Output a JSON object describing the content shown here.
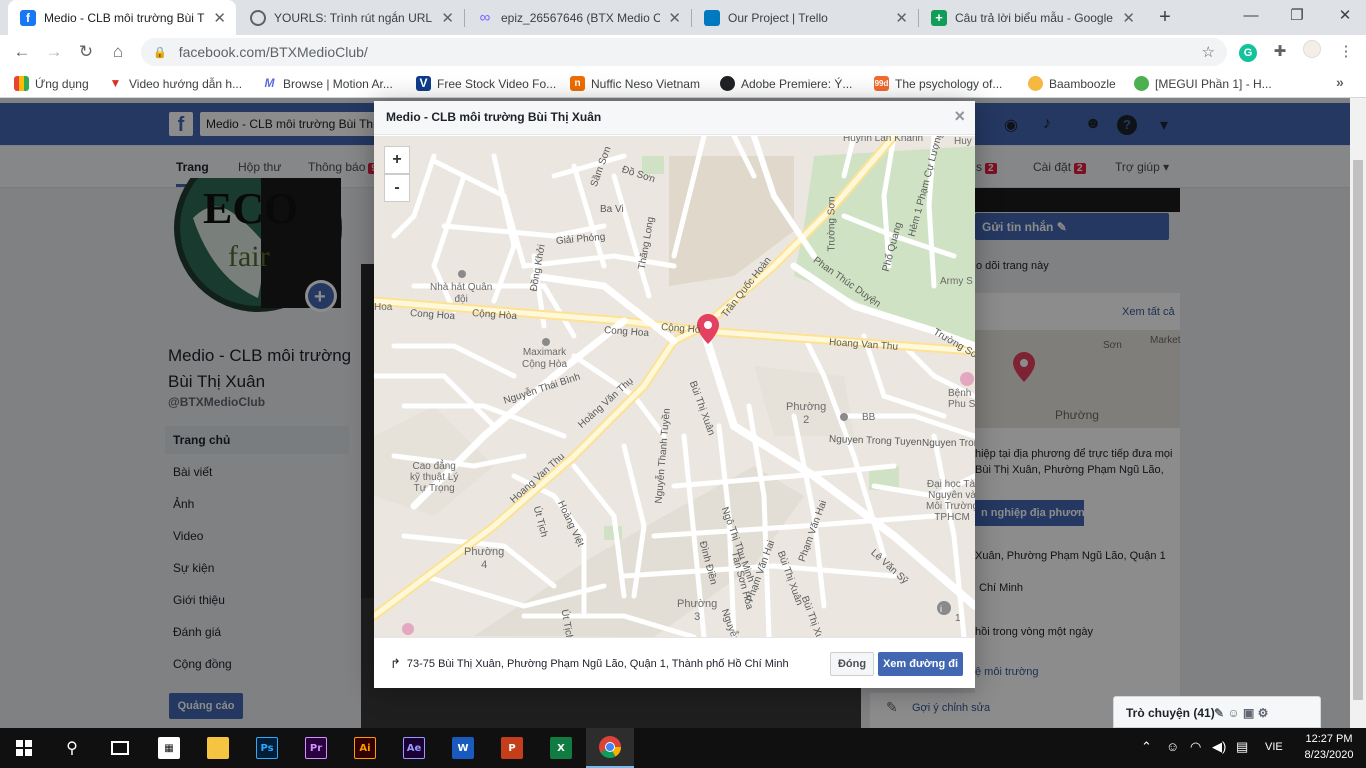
{
  "browser": {
    "tabs": [
      {
        "title": "Medio - CLB môi trường Bùi Thị Xuân",
        "favicon": "facebook-icon",
        "color": "#1877f2",
        "active": true
      },
      {
        "title": "YOURLS: Trình rút ngắn URL của",
        "favicon": "globe-icon",
        "color": "#5f6368",
        "active": false
      },
      {
        "title": "epiz_26567646 (BTX Medio Club",
        "favicon": "infinity-icon",
        "color": "#7b61ff",
        "active": false
      },
      {
        "title": "Our Project | Trello",
        "favicon": "trello-icon",
        "color": "#0079bf",
        "active": false
      },
      {
        "title": "Câu trả lời biểu mẫu - Google",
        "favicon": "google-sheets-icon",
        "color": "#0f9d58",
        "active": false
      }
    ],
    "new_tab": "+",
    "url": "facebook.com/BTXMedioClub/",
    "bookmarks": [
      {
        "label": "Ứng dụng",
        "icon": "apps-grid-icon",
        "color": "#e94235"
      },
      {
        "label": "Video hướng dẫn h...",
        "icon": "bookmark-red-icon",
        "color": "#d93025"
      },
      {
        "label": "Browse | Motion Ar...",
        "icon": "motion-array-icon",
        "color": "#5b6ee1"
      },
      {
        "label": "Free Stock Video Fo...",
        "icon": "v-icon",
        "color": "#0e3b8c"
      },
      {
        "label": "Nuffic Neso Vietnam",
        "icon": "nuffic-icon",
        "color": "#ef6c00"
      },
      {
        "label": "Adobe Premiere: Ý...",
        "icon": "globe-icon",
        "color": "#202124"
      },
      {
        "label": "The psychology of...",
        "icon": "99designs-icon",
        "color": "#f26a2e"
      },
      {
        "label": "Baamboozle",
        "icon": "baamboozle-icon",
        "color": "#f5b942"
      },
      {
        "label": "[MEGUI Phần 1] - H...",
        "icon": "megui-icon",
        "color": "#4caf50"
      }
    ]
  },
  "facebook": {
    "search_value": "Medio - CLB môi trường Bùi Thị",
    "tabs": [
      {
        "label": "Trang",
        "badge": ""
      },
      {
        "label": "Hộp thư",
        "badge": ""
      },
      {
        "label": "Thông báo",
        "badge": "9"
      },
      {
        "label": "",
        "badge": "2"
      },
      {
        "label": "Cài đặt",
        "badge": "2"
      },
      {
        "label": "Trợ giúp ▾",
        "badge": ""
      }
    ],
    "page_name": "Medio - CLB môi trường Bùi Thị Xuân",
    "page_handle": "@BTXMedioClub",
    "nav": [
      "Trang chủ",
      "Bài viết",
      "Ảnh",
      "Video",
      "Sự kiện",
      "Giới thiệu",
      "Đánh giá",
      "Cộng đồng"
    ],
    "promote": "Quảng cáo",
    "send_message": "Gửi tin nhắn",
    "follow_text": "o dõi trang này",
    "see_all": "Xem tất cả",
    "local_text_1": "hiệp tại địa phương để trực tiếp đưa mọi",
    "local_text_2": "Bùi Thị Xuân, Phường Phạm Ngũ Lão,",
    "local_button": "n nghiệp địa phương",
    "address_partial": "Xuân, Phường Phạm Ngũ Lão, Quận 1",
    "city_partial": "Chí Minh",
    "reply_text": "hồi trong vòng một ngày",
    "category_text": "ệ môi trường",
    "suggest_edit": "Gợi ý chỉnh sửa",
    "chat": "Trò chuyện (41)",
    "avatar_text": {
      "eco": "ECO",
      "fair": "fair"
    }
  },
  "dialog": {
    "title": "Medio - CLB môi trường Bùi Thị Xuân",
    "close": "×",
    "zoom_in": "+",
    "zoom_out": "-",
    "address": "73-75 Bùi Thị Xuân, Phường Phạm Ngũ Lão, Quận 1, Thành phố Hồ Chí Minh",
    "close_button": "Đóng",
    "directions_button": "Xem đường đi",
    "map_labels": {
      "huynh_lan_khanh": "Huynh Lan Khanh",
      "do_son": "Đồ Sơn",
      "sam_son": "Sầm Sơn",
      "ba_vi": "Ba Vi",
      "giai_phong": "Giải Phóng",
      "thang_long": "Thăng Long",
      "dong_khoi": "Đồng Khởi",
      "nha_hat": "Nhà hát Quân\nđội",
      "cong_hoa_1": "Cong Hoa",
      "cong_hoa_2": "Cộng Hòa",
      "cong_hoa_3": "Cong Hoa",
      "cong_ho": "Cộng Hò",
      "hoa": "Hoa",
      "maximark": "Maximark\nCộng Hòa",
      "tran_quoc_hoan": "Trần Quốc Hoàn",
      "phan_thuc_duyen": "Phan Thúc Duyện",
      "truong_son": "Trường Sơn",
      "truong_so": "Trường Sơ",
      "pho_quang": "Phổ Quang",
      "hem_pham_cu_luong": "Hẻm 1 Phạm Cự Lượng",
      "army": "Army S",
      "huy": "Huy",
      "hoang_van_thu": "Hoang Van Thu",
      "hoang_van_thu_2": "Hoàng Văn Thụ",
      "hoang_van_thu_3": "Hoang Van Thu",
      "nguyen_thai_binh": "Nguyễn Thái Bình",
      "bui_thi_xuan": "Bùi Thị Xuân",
      "phuong_2": "Phường\n2",
      "bb": "BB",
      "nguyen_trong_tuyen": "Nguyen Trong Tuyen",
      "nguyen_tro": "Nguyen Tror",
      "benh_vien": "Bệnh\nPhu S",
      "cao_dang": "Cao đẳng\nkỹ thuật Lý\nTự Trọng",
      "ut_tich": "Út Tịch",
      "hoang_viet": "Hoàng Việt",
      "nguyen_thanh_tuyen": "Nguyễn Thanh Tuyền",
      "ngo_thi_thu_minh": "Ngô Thị Thu Minh",
      "dinh_dien": "Đình Điền",
      "tan_son_hoa": "Tân Sơn Hòa",
      "bui_thi_xuan_2": "Bùi Thị Xuân",
      "pham_van_hai": "Phạm Văn Hai",
      "dai_hoc": "Đại học Tài\nNguyên và\nMôi Trường\nTPHCM",
      "le_van_sy": "Lê Văn Sỹ",
      "phuong_4": "Phường\n4",
      "phuong_3": "Phường\n3",
      "ut_tich_2": "Út Tịch",
      "nguyen": "Nguyễn",
      "pham_van_hai_2": "Phạm Văn Hai",
      "bui_thi_xuan_3": "Bùi Thị Xuân",
      "side_1": "1",
      "side_phuong": "Phường",
      "side_market": "Market",
      "side_son": "Sơn"
    }
  },
  "taskbar": {
    "apps": [
      {
        "name": "start-icon",
        "label": ""
      },
      {
        "name": "search-icon",
        "label": ""
      },
      {
        "name": "task-view-icon",
        "label": ""
      },
      {
        "name": "store-icon",
        "label": ""
      },
      {
        "name": "file-explorer-icon",
        "label": ""
      },
      {
        "name": "photoshop-icon",
        "label": "Ps",
        "bg": "#001e36",
        "fg": "#31a8ff"
      },
      {
        "name": "premiere-icon",
        "label": "Pr",
        "bg": "#2a003f",
        "fg": "#d291ff"
      },
      {
        "name": "illustrator-icon",
        "label": "Ai",
        "bg": "#330000",
        "fg": "#ff9a00"
      },
      {
        "name": "after-effects-icon",
        "label": "Ae",
        "bg": "#1a0033",
        "fg": "#9999ff"
      },
      {
        "name": "word-icon",
        "label": "W",
        "bg": "#185abd",
        "fg": "#ffffff"
      },
      {
        "name": "powerpoint-icon",
        "label": "P",
        "bg": "#c43e1c",
        "fg": "#ffffff"
      },
      {
        "name": "excel-icon",
        "label": "X",
        "bg": "#107c41",
        "fg": "#ffffff"
      },
      {
        "name": "chrome-icon",
        "label": ""
      }
    ],
    "language": "VIE",
    "time": "12:27 PM",
    "date": "8/23/2020"
  }
}
